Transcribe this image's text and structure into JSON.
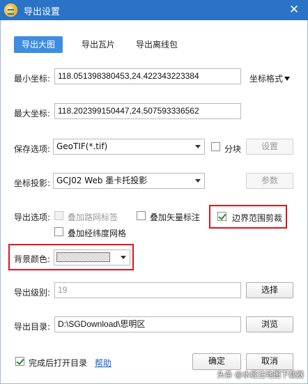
{
  "window": {
    "title": "导出设置"
  },
  "tabs": [
    {
      "label": "导出大图",
      "active": true
    },
    {
      "label": "导出瓦片",
      "active": false
    },
    {
      "label": "导出离线包",
      "active": false
    }
  ],
  "min_coord": {
    "label": "最小坐标:",
    "value": "118.051398380453,24.422343223384"
  },
  "coord_format": {
    "label": "坐标格式"
  },
  "max_coord": {
    "label": "最大坐标:",
    "value": "118.202399150447,24.507593336562"
  },
  "save_option": {
    "label": "保存选项:",
    "value": "GeoTIF(*.tif)",
    "split_label": "分块",
    "settings_label": "设置"
  },
  "projection": {
    "label": "坐标投影:",
    "value": "GCJ02 Web 墨卡托投影",
    "params_label": "参数"
  },
  "export_options": {
    "label": "导出选项:",
    "road_labels": "叠加路网标签",
    "vector_labels": "叠加矢量标注",
    "boundary_clip": "边界范围剪裁",
    "graticule": "叠加经纬度网格"
  },
  "background": {
    "label": "背景颜色:"
  },
  "level": {
    "label": "导出级别:",
    "value": "19",
    "select_label": "选择"
  },
  "directory": {
    "label": "导出目录:",
    "value": "D:\\SGDownload\\思明区",
    "browse_label": "浏览"
  },
  "footer": {
    "open_dir_label": "完成后打开目录",
    "help_label": "帮助",
    "ok_label": "确定",
    "cancel_label": "取消"
  },
  "watermark": "头条 @水经注地图下载器",
  "colors": {
    "titlebar": "#2a73c6",
    "active_tab": "#3d8de0",
    "highlight": "#e0141e",
    "link": "#1a5fc7"
  }
}
